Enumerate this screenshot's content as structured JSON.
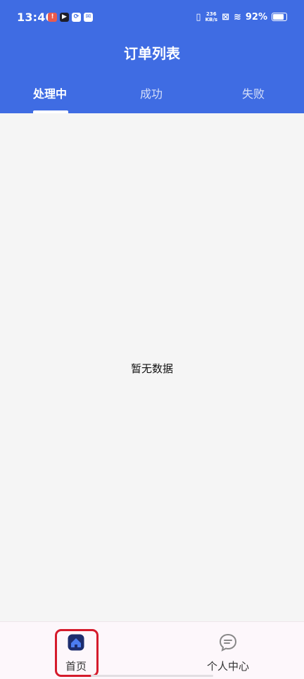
{
  "status_bar": {
    "time": "13:40",
    "speed_top": "236",
    "speed_bottom": "KB/s",
    "battery": "92%",
    "battery_level": 0.92,
    "left_icons": [
      "app-badge-red",
      "app-badge-dark",
      "link-icon",
      "mail-icon"
    ]
  },
  "header": {
    "title": "订单列表",
    "accent_color": "#3f6ce3"
  },
  "tabs": [
    {
      "label": "处理中",
      "active": true
    },
    {
      "label": "成功",
      "active": false
    },
    {
      "label": "失败",
      "active": false
    }
  ],
  "content": {
    "empty_text": "暂无数据"
  },
  "bottom_nav": {
    "items": [
      {
        "label": "首页",
        "icon": "home-icon",
        "active": true
      },
      {
        "label": "个人中心",
        "icon": "chat-icon",
        "active": false
      }
    ],
    "highlight_color": "#d51b2c"
  }
}
